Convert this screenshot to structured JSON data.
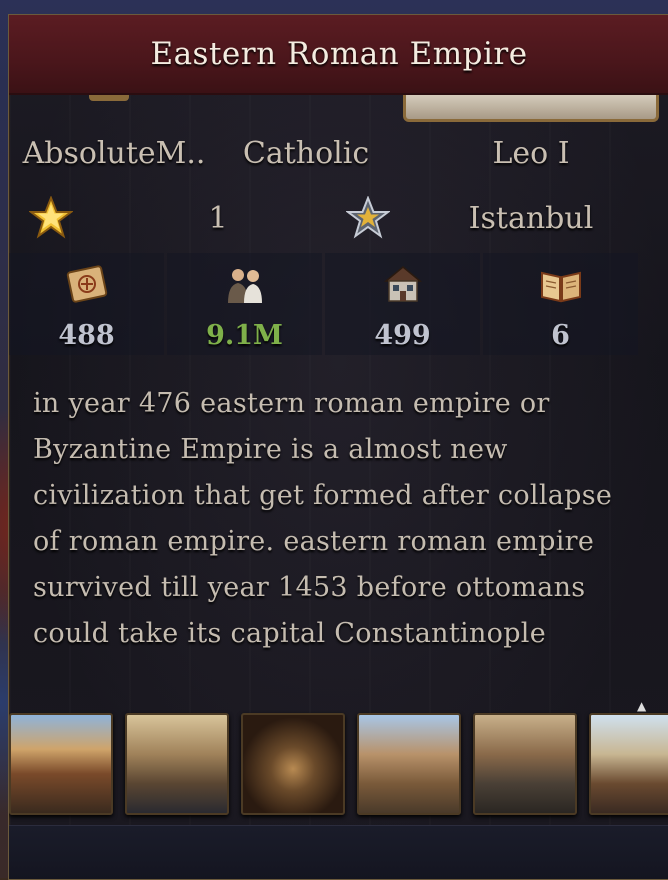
{
  "window": {
    "title": "Eastern Roman Empire"
  },
  "info": {
    "government": "AbsoluteM..",
    "religion": "Catholic",
    "ruler": "Leo I"
  },
  "capital_row": {
    "rank_icon": "gold-star-icon",
    "rank_value": "1",
    "capital_icon": "silver-star-icon",
    "capital_name": "Istanbul"
  },
  "stats": [
    {
      "icon": "scroll-map-icon",
      "value": "488",
      "color": "#c0c3cf"
    },
    {
      "icon": "people-icon",
      "value": "9.1M",
      "color": "#7fb04a"
    },
    {
      "icon": "house-icon",
      "value": "499",
      "color": "#c0c3cf"
    },
    {
      "icon": "book-icon",
      "value": "6",
      "color": "#c0c3cf"
    }
  ],
  "description": "in year 476 eastern roman empire or Byzantine Empire is a almost new civilization that get formed after collapse of roman empire. eastern roman empire survived till year 1453 before ottomans could take its capital Constantinople",
  "gallery": [
    {
      "name": "town-street-thumbnail"
    },
    {
      "name": "river-city-thumbnail"
    },
    {
      "name": "coin-sack-thumbnail"
    },
    {
      "name": "construction-thumbnail"
    },
    {
      "name": "soldiers-march-thumbnail"
    },
    {
      "name": "cannon-thumbnail"
    }
  ],
  "bottom": {
    "label": ""
  }
}
